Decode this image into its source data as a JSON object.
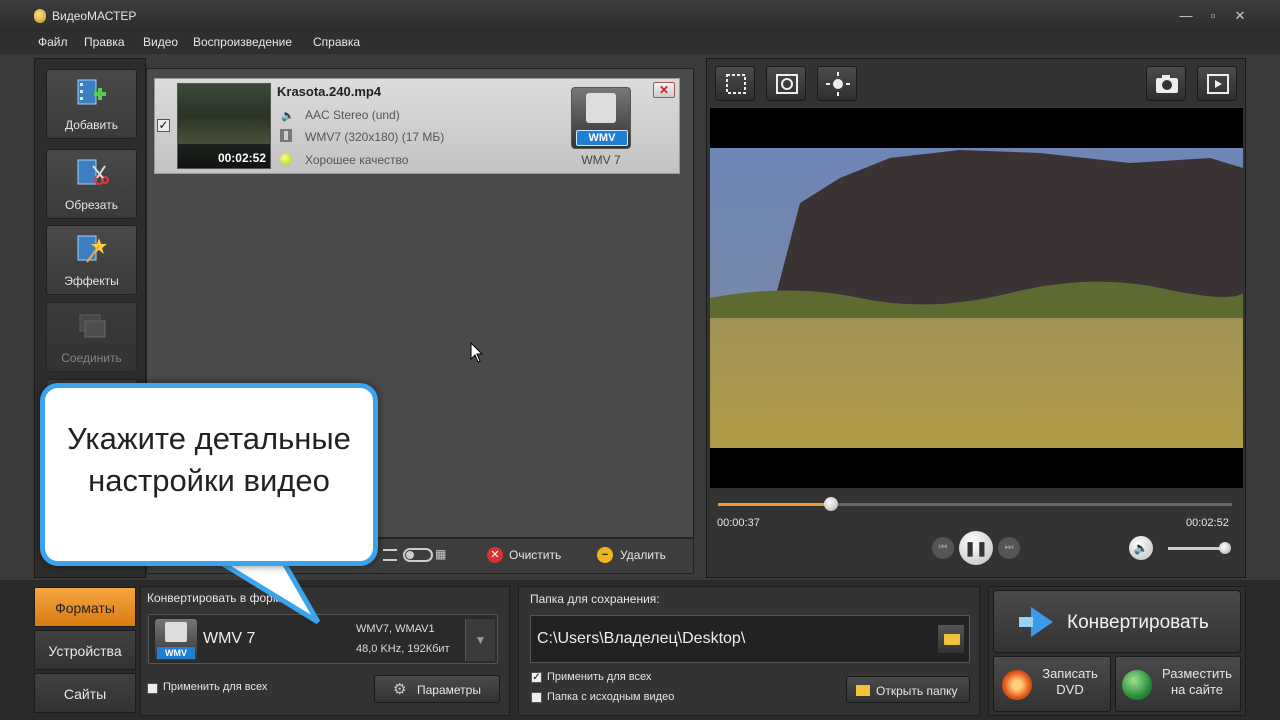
{
  "app": {
    "title": "ВидеоМАСТЕР"
  },
  "menu": [
    "Файл",
    "Правка",
    "Видео",
    "Воспроизведение",
    "Справка"
  ],
  "tools": [
    {
      "label": "Добавить"
    },
    {
      "label": "Обрезать"
    },
    {
      "label": "Эффекты"
    },
    {
      "label": "Соединить"
    }
  ],
  "file": {
    "name": "Krasota.240.mp4",
    "audio": "AAC Stereo (und)",
    "video": "WMV7 (320x180) (17 МБ)",
    "quality": "Хорошее качество",
    "duration": "00:02:52",
    "format_badge": "WMV",
    "format_label": "WMV 7",
    "checked": true
  },
  "list_actions": {
    "clear": "Очистить",
    "delete": "Удалить"
  },
  "player": {
    "current_time": "00:00:37",
    "total_time": "00:02:52",
    "progress_fraction": 0.22,
    "volume_fraction": 0.92
  },
  "tabs": [
    "Форматы",
    "Устройства",
    "Сайты"
  ],
  "format": {
    "section_label": "Конвертировать в формат:",
    "name": "WMV 7",
    "badge": "WMV",
    "codecs": "WMV7, WMAV1",
    "params": "48,0 KHz, 192Кбит",
    "apply_all": "Применить для всех",
    "settings_button": "Параметры"
  },
  "save": {
    "section_label": "Папка для сохранения:",
    "path": "C:\\Users\\Владелец\\Desktop\\",
    "apply_all": "Применить для всех",
    "source_folder": "Папка с исходным видео",
    "open_folder": "Открыть папку"
  },
  "actions": {
    "convert": "Конвертировать",
    "burn_dvd": "Записать\nDVD",
    "publish": "Разместить\nна сайте"
  },
  "callout": {
    "text": "Укажите детальные настройки видео"
  },
  "colors": {
    "accent": "#f29a2e",
    "callout_border": "#3aa5ee",
    "wmv_blue": "#1f7fd4"
  }
}
